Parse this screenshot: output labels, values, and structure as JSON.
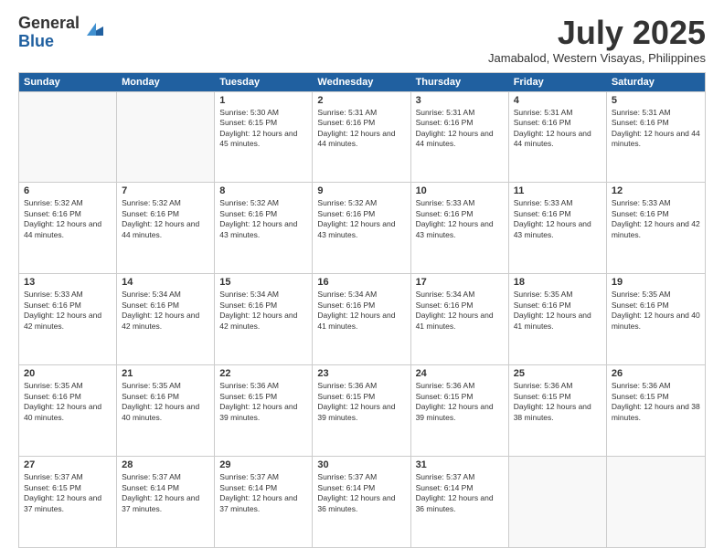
{
  "logo": {
    "general": "General",
    "blue": "Blue"
  },
  "header": {
    "month": "July 2025",
    "location": "Jamabalod, Western Visayas, Philippines"
  },
  "weekdays": [
    "Sunday",
    "Monday",
    "Tuesday",
    "Wednesday",
    "Thursday",
    "Friday",
    "Saturday"
  ],
  "weeks": [
    [
      {
        "day": "",
        "sunrise": "",
        "sunset": "",
        "daylight": ""
      },
      {
        "day": "",
        "sunrise": "",
        "sunset": "",
        "daylight": ""
      },
      {
        "day": "1",
        "sunrise": "Sunrise: 5:30 AM",
        "sunset": "Sunset: 6:15 PM",
        "daylight": "Daylight: 12 hours and 45 minutes."
      },
      {
        "day": "2",
        "sunrise": "Sunrise: 5:31 AM",
        "sunset": "Sunset: 6:16 PM",
        "daylight": "Daylight: 12 hours and 44 minutes."
      },
      {
        "day": "3",
        "sunrise": "Sunrise: 5:31 AM",
        "sunset": "Sunset: 6:16 PM",
        "daylight": "Daylight: 12 hours and 44 minutes."
      },
      {
        "day": "4",
        "sunrise": "Sunrise: 5:31 AM",
        "sunset": "Sunset: 6:16 PM",
        "daylight": "Daylight: 12 hours and 44 minutes."
      },
      {
        "day": "5",
        "sunrise": "Sunrise: 5:31 AM",
        "sunset": "Sunset: 6:16 PM",
        "daylight": "Daylight: 12 hours and 44 minutes."
      }
    ],
    [
      {
        "day": "6",
        "sunrise": "Sunrise: 5:32 AM",
        "sunset": "Sunset: 6:16 PM",
        "daylight": "Daylight: 12 hours and 44 minutes."
      },
      {
        "day": "7",
        "sunrise": "Sunrise: 5:32 AM",
        "sunset": "Sunset: 6:16 PM",
        "daylight": "Daylight: 12 hours and 44 minutes."
      },
      {
        "day": "8",
        "sunrise": "Sunrise: 5:32 AM",
        "sunset": "Sunset: 6:16 PM",
        "daylight": "Daylight: 12 hours and 43 minutes."
      },
      {
        "day": "9",
        "sunrise": "Sunrise: 5:32 AM",
        "sunset": "Sunset: 6:16 PM",
        "daylight": "Daylight: 12 hours and 43 minutes."
      },
      {
        "day": "10",
        "sunrise": "Sunrise: 5:33 AM",
        "sunset": "Sunset: 6:16 PM",
        "daylight": "Daylight: 12 hours and 43 minutes."
      },
      {
        "day": "11",
        "sunrise": "Sunrise: 5:33 AM",
        "sunset": "Sunset: 6:16 PM",
        "daylight": "Daylight: 12 hours and 43 minutes."
      },
      {
        "day": "12",
        "sunrise": "Sunrise: 5:33 AM",
        "sunset": "Sunset: 6:16 PM",
        "daylight": "Daylight: 12 hours and 42 minutes."
      }
    ],
    [
      {
        "day": "13",
        "sunrise": "Sunrise: 5:33 AM",
        "sunset": "Sunset: 6:16 PM",
        "daylight": "Daylight: 12 hours and 42 minutes."
      },
      {
        "day": "14",
        "sunrise": "Sunrise: 5:34 AM",
        "sunset": "Sunset: 6:16 PM",
        "daylight": "Daylight: 12 hours and 42 minutes."
      },
      {
        "day": "15",
        "sunrise": "Sunrise: 5:34 AM",
        "sunset": "Sunset: 6:16 PM",
        "daylight": "Daylight: 12 hours and 42 minutes."
      },
      {
        "day": "16",
        "sunrise": "Sunrise: 5:34 AM",
        "sunset": "Sunset: 6:16 PM",
        "daylight": "Daylight: 12 hours and 41 minutes."
      },
      {
        "day": "17",
        "sunrise": "Sunrise: 5:34 AM",
        "sunset": "Sunset: 6:16 PM",
        "daylight": "Daylight: 12 hours and 41 minutes."
      },
      {
        "day": "18",
        "sunrise": "Sunrise: 5:35 AM",
        "sunset": "Sunset: 6:16 PM",
        "daylight": "Daylight: 12 hours and 41 minutes."
      },
      {
        "day": "19",
        "sunrise": "Sunrise: 5:35 AM",
        "sunset": "Sunset: 6:16 PM",
        "daylight": "Daylight: 12 hours and 40 minutes."
      }
    ],
    [
      {
        "day": "20",
        "sunrise": "Sunrise: 5:35 AM",
        "sunset": "Sunset: 6:16 PM",
        "daylight": "Daylight: 12 hours and 40 minutes."
      },
      {
        "day": "21",
        "sunrise": "Sunrise: 5:35 AM",
        "sunset": "Sunset: 6:16 PM",
        "daylight": "Daylight: 12 hours and 40 minutes."
      },
      {
        "day": "22",
        "sunrise": "Sunrise: 5:36 AM",
        "sunset": "Sunset: 6:15 PM",
        "daylight": "Daylight: 12 hours and 39 minutes."
      },
      {
        "day": "23",
        "sunrise": "Sunrise: 5:36 AM",
        "sunset": "Sunset: 6:15 PM",
        "daylight": "Daylight: 12 hours and 39 minutes."
      },
      {
        "day": "24",
        "sunrise": "Sunrise: 5:36 AM",
        "sunset": "Sunset: 6:15 PM",
        "daylight": "Daylight: 12 hours and 39 minutes."
      },
      {
        "day": "25",
        "sunrise": "Sunrise: 5:36 AM",
        "sunset": "Sunset: 6:15 PM",
        "daylight": "Daylight: 12 hours and 38 minutes."
      },
      {
        "day": "26",
        "sunrise": "Sunrise: 5:36 AM",
        "sunset": "Sunset: 6:15 PM",
        "daylight": "Daylight: 12 hours and 38 minutes."
      }
    ],
    [
      {
        "day": "27",
        "sunrise": "Sunrise: 5:37 AM",
        "sunset": "Sunset: 6:15 PM",
        "daylight": "Daylight: 12 hours and 37 minutes."
      },
      {
        "day": "28",
        "sunrise": "Sunrise: 5:37 AM",
        "sunset": "Sunset: 6:14 PM",
        "daylight": "Daylight: 12 hours and 37 minutes."
      },
      {
        "day": "29",
        "sunrise": "Sunrise: 5:37 AM",
        "sunset": "Sunset: 6:14 PM",
        "daylight": "Daylight: 12 hours and 37 minutes."
      },
      {
        "day": "30",
        "sunrise": "Sunrise: 5:37 AM",
        "sunset": "Sunset: 6:14 PM",
        "daylight": "Daylight: 12 hours and 36 minutes."
      },
      {
        "day": "31",
        "sunrise": "Sunrise: 5:37 AM",
        "sunset": "Sunset: 6:14 PM",
        "daylight": "Daylight: 12 hours and 36 minutes."
      },
      {
        "day": "",
        "sunrise": "",
        "sunset": "",
        "daylight": ""
      },
      {
        "day": "",
        "sunrise": "",
        "sunset": "",
        "daylight": ""
      }
    ]
  ]
}
